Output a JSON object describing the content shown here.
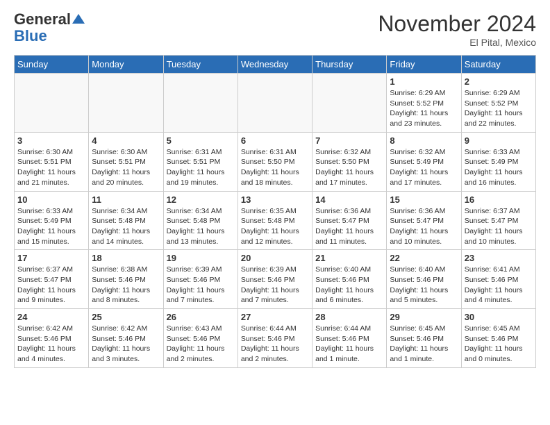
{
  "header": {
    "logo_general": "General",
    "logo_blue": "Blue",
    "month_title": "November 2024",
    "location": "El Pital, Mexico"
  },
  "weekdays": [
    "Sunday",
    "Monday",
    "Tuesday",
    "Wednesday",
    "Thursday",
    "Friday",
    "Saturday"
  ],
  "weeks": [
    [
      {
        "day": "",
        "info": ""
      },
      {
        "day": "",
        "info": ""
      },
      {
        "day": "",
        "info": ""
      },
      {
        "day": "",
        "info": ""
      },
      {
        "day": "",
        "info": ""
      },
      {
        "day": "1",
        "info": "Sunrise: 6:29 AM\nSunset: 5:52 PM\nDaylight: 11 hours and 23 minutes."
      },
      {
        "day": "2",
        "info": "Sunrise: 6:29 AM\nSunset: 5:52 PM\nDaylight: 11 hours and 22 minutes."
      }
    ],
    [
      {
        "day": "3",
        "info": "Sunrise: 6:30 AM\nSunset: 5:51 PM\nDaylight: 11 hours and 21 minutes."
      },
      {
        "day": "4",
        "info": "Sunrise: 6:30 AM\nSunset: 5:51 PM\nDaylight: 11 hours and 20 minutes."
      },
      {
        "day": "5",
        "info": "Sunrise: 6:31 AM\nSunset: 5:51 PM\nDaylight: 11 hours and 19 minutes."
      },
      {
        "day": "6",
        "info": "Sunrise: 6:31 AM\nSunset: 5:50 PM\nDaylight: 11 hours and 18 minutes."
      },
      {
        "day": "7",
        "info": "Sunrise: 6:32 AM\nSunset: 5:50 PM\nDaylight: 11 hours and 17 minutes."
      },
      {
        "day": "8",
        "info": "Sunrise: 6:32 AM\nSunset: 5:49 PM\nDaylight: 11 hours and 17 minutes."
      },
      {
        "day": "9",
        "info": "Sunrise: 6:33 AM\nSunset: 5:49 PM\nDaylight: 11 hours and 16 minutes."
      }
    ],
    [
      {
        "day": "10",
        "info": "Sunrise: 6:33 AM\nSunset: 5:49 PM\nDaylight: 11 hours and 15 minutes."
      },
      {
        "day": "11",
        "info": "Sunrise: 6:34 AM\nSunset: 5:48 PM\nDaylight: 11 hours and 14 minutes."
      },
      {
        "day": "12",
        "info": "Sunrise: 6:34 AM\nSunset: 5:48 PM\nDaylight: 11 hours and 13 minutes."
      },
      {
        "day": "13",
        "info": "Sunrise: 6:35 AM\nSunset: 5:48 PM\nDaylight: 11 hours and 12 minutes."
      },
      {
        "day": "14",
        "info": "Sunrise: 6:36 AM\nSunset: 5:47 PM\nDaylight: 11 hours and 11 minutes."
      },
      {
        "day": "15",
        "info": "Sunrise: 6:36 AM\nSunset: 5:47 PM\nDaylight: 11 hours and 10 minutes."
      },
      {
        "day": "16",
        "info": "Sunrise: 6:37 AM\nSunset: 5:47 PM\nDaylight: 11 hours and 10 minutes."
      }
    ],
    [
      {
        "day": "17",
        "info": "Sunrise: 6:37 AM\nSunset: 5:47 PM\nDaylight: 11 hours and 9 minutes."
      },
      {
        "day": "18",
        "info": "Sunrise: 6:38 AM\nSunset: 5:46 PM\nDaylight: 11 hours and 8 minutes."
      },
      {
        "day": "19",
        "info": "Sunrise: 6:39 AM\nSunset: 5:46 PM\nDaylight: 11 hours and 7 minutes."
      },
      {
        "day": "20",
        "info": "Sunrise: 6:39 AM\nSunset: 5:46 PM\nDaylight: 11 hours and 7 minutes."
      },
      {
        "day": "21",
        "info": "Sunrise: 6:40 AM\nSunset: 5:46 PM\nDaylight: 11 hours and 6 minutes."
      },
      {
        "day": "22",
        "info": "Sunrise: 6:40 AM\nSunset: 5:46 PM\nDaylight: 11 hours and 5 minutes."
      },
      {
        "day": "23",
        "info": "Sunrise: 6:41 AM\nSunset: 5:46 PM\nDaylight: 11 hours and 4 minutes."
      }
    ],
    [
      {
        "day": "24",
        "info": "Sunrise: 6:42 AM\nSunset: 5:46 PM\nDaylight: 11 hours and 4 minutes."
      },
      {
        "day": "25",
        "info": "Sunrise: 6:42 AM\nSunset: 5:46 PM\nDaylight: 11 hours and 3 minutes."
      },
      {
        "day": "26",
        "info": "Sunrise: 6:43 AM\nSunset: 5:46 PM\nDaylight: 11 hours and 2 minutes."
      },
      {
        "day": "27",
        "info": "Sunrise: 6:44 AM\nSunset: 5:46 PM\nDaylight: 11 hours and 2 minutes."
      },
      {
        "day": "28",
        "info": "Sunrise: 6:44 AM\nSunset: 5:46 PM\nDaylight: 11 hours and 1 minute."
      },
      {
        "day": "29",
        "info": "Sunrise: 6:45 AM\nSunset: 5:46 PM\nDaylight: 11 hours and 1 minute."
      },
      {
        "day": "30",
        "info": "Sunrise: 6:45 AM\nSunset: 5:46 PM\nDaylight: 11 hours and 0 minutes."
      }
    ]
  ]
}
